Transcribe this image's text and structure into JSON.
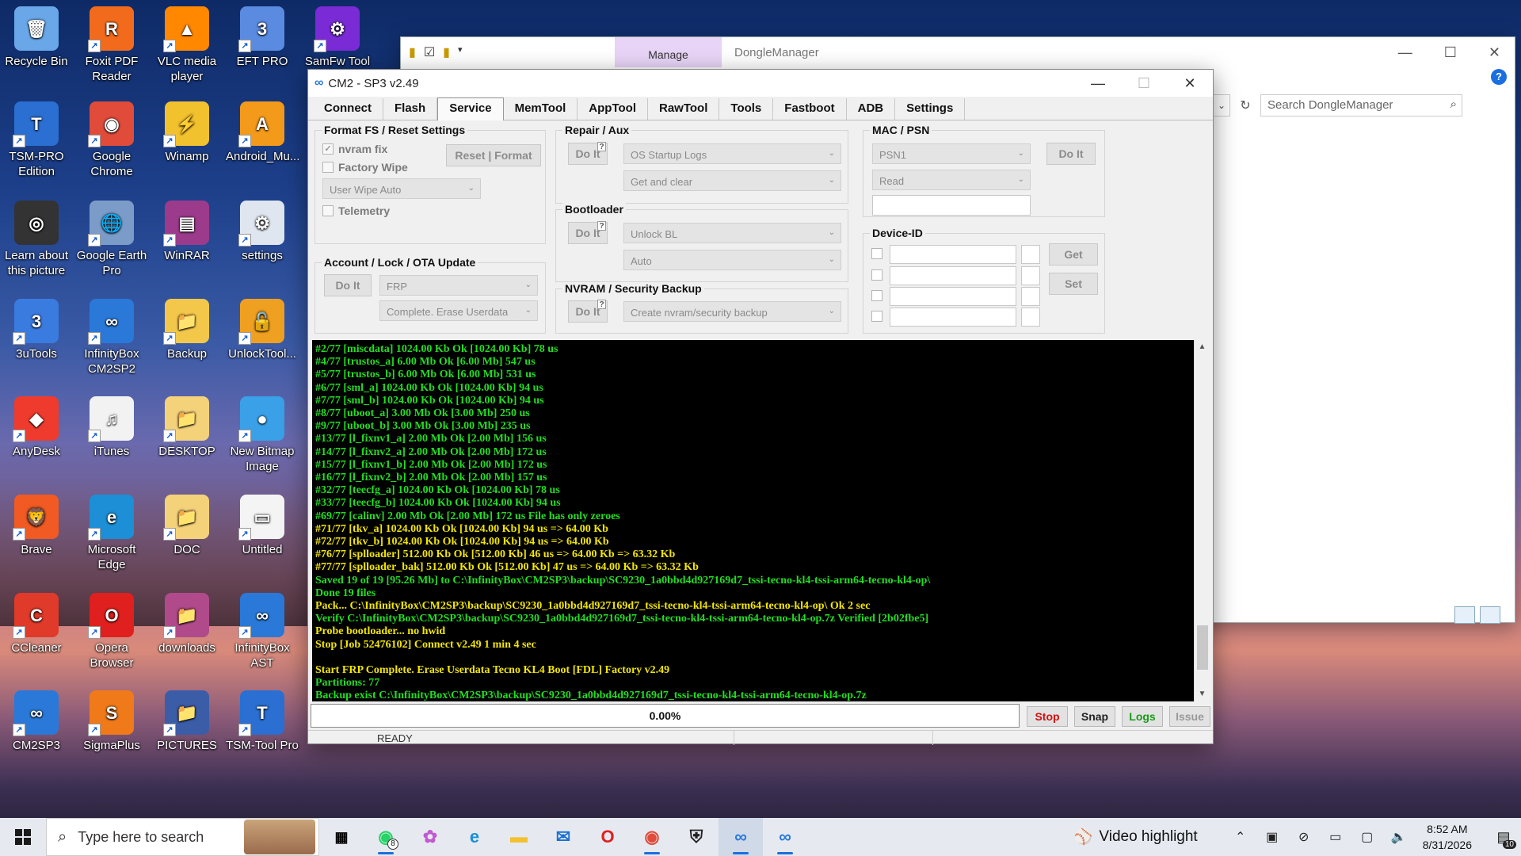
{
  "desktop_icons": [
    {
      "label": "Recycle Bin",
      "icon": "recycle-bin-icon",
      "color": "#6aa7e8",
      "glyph": "🗑"
    },
    {
      "label": "Foxit PDF Reader",
      "icon": "foxit-reader-icon",
      "color": "#f26b1d",
      "glyph": "R"
    },
    {
      "label": "VLC media player",
      "icon": "vlc-icon",
      "color": "#ff8800",
      "glyph": "▲"
    },
    {
      "label": "EFT PRO",
      "icon": "eft-pro-icon",
      "color": "#5a8be0",
      "glyph": "3"
    },
    {
      "label": "SamFw Tool",
      "icon": "samfw-tool-icon",
      "color": "#7a2bd6",
      "glyph": "⚙"
    },
    {
      "label": "TSM-PRO Edition",
      "icon": "tsm-pro-icon",
      "color": "#2a6fd1",
      "glyph": "T"
    },
    {
      "label": "Google Chrome",
      "icon": "chrome-icon",
      "color": "#e04b3a",
      "glyph": "◉"
    },
    {
      "label": "Winamp",
      "icon": "winamp-icon",
      "color": "#f2c12e",
      "glyph": "⚡"
    },
    {
      "label": "Android_Mu...",
      "icon": "android-multitool-icon",
      "color": "#f39a1a",
      "glyph": "A"
    },
    {
      "label": "Learn about this picture",
      "icon": "learn-picture-icon",
      "color": "#333333",
      "glyph": "◎"
    },
    {
      "label": "Google Earth Pro",
      "icon": "google-earth-icon",
      "color": "#7b9cc9",
      "glyph": "🌐"
    },
    {
      "label": "WinRAR",
      "icon": "winrar-icon",
      "color": "#9c3b8c",
      "glyph": "▤"
    },
    {
      "label": "settings",
      "icon": "settings-file-icon",
      "color": "#dfe6ef",
      "glyph": "⚙"
    },
    {
      "label": "3uTools",
      "icon": "3utools-icon",
      "color": "#3a7be0",
      "glyph": "3"
    },
    {
      "label": "InfinityBox CM2SP2",
      "icon": "infinitybox-cm2sp2-icon",
      "color": "#2a79d8",
      "glyph": "∞"
    },
    {
      "label": "Backup",
      "icon": "backup-folder-icon",
      "color": "#f3c84a",
      "glyph": "📁"
    },
    {
      "label": "UnlockTool...",
      "icon": "unlocktool-icon",
      "color": "#f0a020",
      "glyph": "🔓"
    },
    {
      "label": "AnyDesk",
      "icon": "anydesk-icon",
      "color": "#ef3b2d",
      "glyph": "◆"
    },
    {
      "label": "iTunes",
      "icon": "itunes-icon",
      "color": "#f2f2f2",
      "glyph": "♫"
    },
    {
      "label": "DESKTOP",
      "icon": "desktop-folder-icon",
      "color": "#f3d27a",
      "glyph": "📁"
    },
    {
      "label": "New Bitmap Image",
      "icon": "bitmap-image-icon",
      "color": "#3aa0e8",
      "glyph": "●"
    },
    {
      "label": "Brave",
      "icon": "brave-icon",
      "color": "#f15a22",
      "glyph": "🦁"
    },
    {
      "label": "Microsoft Edge",
      "icon": "edge-icon",
      "color": "#1c8fd6",
      "glyph": "e"
    },
    {
      "label": "DOC",
      "icon": "doc-folder-icon",
      "color": "#f3d27a",
      "glyph": "📁"
    },
    {
      "label": "Untitled",
      "icon": "untitled-file-icon",
      "color": "#f4f4f4",
      "glyph": "▭"
    },
    {
      "label": "CCleaner",
      "icon": "ccleaner-icon",
      "color": "#e03a2a",
      "glyph": "C"
    },
    {
      "label": "Opera Browser",
      "icon": "opera-icon",
      "color": "#e0201e",
      "glyph": "O"
    },
    {
      "label": "downloads",
      "icon": "downloads-folder-icon",
      "color": "#b04a8a",
      "glyph": "📁"
    },
    {
      "label": "InfinityBox AST",
      "icon": "infinitybox-ast-icon",
      "color": "#2a79d8",
      "glyph": "∞"
    },
    {
      "label": "CM2SP3",
      "icon": "cm2sp3-icon",
      "color": "#2a79d8",
      "glyph": "∞"
    },
    {
      "label": "SigmaPlus",
      "icon": "sigmaplus-icon",
      "color": "#f07a1a",
      "glyph": "S"
    },
    {
      "label": "PICTURES",
      "icon": "pictures-folder-icon",
      "color": "#3b5da8",
      "glyph": "📁"
    },
    {
      "label": "TSM-Tool Pro",
      "icon": "tsm-tool-pro-icon",
      "color": "#2a6fd1",
      "glyph": "T"
    }
  ],
  "explorer": {
    "manage_tab": "Manage",
    "title": "DongleManager",
    "search_placeholder": "Search DongleManager"
  },
  "cm2": {
    "title": "CM2 - SP3 v2.49",
    "tabs": [
      "Connect",
      "Flash",
      "Service",
      "MemTool",
      "AppTool",
      "RawTool",
      "Tools",
      "Fastboot",
      "ADB",
      "Settings"
    ],
    "active_tab": "Service",
    "format_fs": {
      "title": "Format FS / Reset Settings",
      "nvram_fix": "nvram fix",
      "factory_wipe": "Factory Wipe",
      "reset_format": "Reset | Format",
      "wipe_mode": "User Wipe Auto",
      "telemetry": "Telemetry"
    },
    "account": {
      "title": "Account / Lock / OTA Update",
      "do_it": "Do It",
      "mode": "FRP",
      "action": "Complete. Erase Userdata"
    },
    "repair": {
      "title": "Repair / Aux",
      "do_it": "Do It",
      "mode": "OS Startup Logs",
      "action": "Get and clear"
    },
    "bootloader": {
      "title": "Bootloader",
      "do_it": "Do It",
      "mode": "Unlock BL",
      "action": "Auto"
    },
    "nvram": {
      "title": "NVRAM / Security Backup",
      "do_it": "Do It",
      "mode": "Create nvram/security backup"
    },
    "mac_psn": {
      "title": "MAC / PSN",
      "mode": "PSN1",
      "action": "Read",
      "do_it": "Do It"
    },
    "device_id": {
      "title": "Device-ID",
      "get": "Get",
      "set": "Set"
    },
    "console_lines": [
      {
        "t": "#2/77 [miscdata] 1024.00 Kb Ok [1024.00 Kb] 78 us",
        "c": "g"
      },
      {
        "t": "#4/77 [trustos_a] 6.00 Mb Ok [6.00 Mb] 547 us",
        "c": "g"
      },
      {
        "t": "#5/77 [trustos_b] 6.00 Mb Ok [6.00 Mb] 531 us",
        "c": "g"
      },
      {
        "t": "#6/77 [sml_a] 1024.00 Kb Ok [1024.00 Kb] 94 us",
        "c": "g"
      },
      {
        "t": "#7/77 [sml_b] 1024.00 Kb Ok [1024.00 Kb] 94 us",
        "c": "g"
      },
      {
        "t": "#8/77 [uboot_a] 3.00 Mb Ok [3.00 Mb] 250 us",
        "c": "g"
      },
      {
        "t": "#9/77 [uboot_b] 3.00 Mb Ok [3.00 Mb] 235 us",
        "c": "g"
      },
      {
        "t": "#13/77 [l_fixnv1_a] 2.00 Mb Ok [2.00 Mb] 156 us",
        "c": "g"
      },
      {
        "t": "#14/77 [l_fixnv2_a] 2.00 Mb Ok [2.00 Mb] 172 us",
        "c": "g"
      },
      {
        "t": "#15/77 [l_fixnv1_b] 2.00 Mb Ok [2.00 Mb] 172 us",
        "c": "g"
      },
      {
        "t": "#16/77 [l_fixnv2_b] 2.00 Mb Ok [2.00 Mb] 157 us",
        "c": "g"
      },
      {
        "t": "#32/77 [teecfg_a] 1024.00 Kb Ok [1024.00 Kb] 78 us",
        "c": "g"
      },
      {
        "t": "#33/77 [teecfg_b] 1024.00 Kb Ok [1024.00 Kb] 94 us",
        "c": "g"
      },
      {
        "t": "#69/77 [calinv] 2.00 Mb Ok [2.00 Mb] 172 us File has only zeroes",
        "c": "g"
      },
      {
        "t": "#71/77 [tkv_a] 1024.00 Kb Ok [1024.00 Kb] 94 us => 64.00 Kb",
        "c": "y"
      },
      {
        "t": "#72/77 [tkv_b] 1024.00 Kb Ok [1024.00 Kb] 94 us => 64.00 Kb",
        "c": "y"
      },
      {
        "t": "#76/77 [splloader] 512.00 Kb Ok [512.00 Kb] 46 us => 64.00 Kb => 63.32 Kb",
        "c": "y"
      },
      {
        "t": "#77/77 [splloader_bak] 512.00 Kb Ok [512.00 Kb] 47 us => 64.00 Kb => 63.32 Kb",
        "c": "y"
      },
      {
        "t": "Saved 19 of 19 [95.26 Mb] to C:\\InfinityBox\\CM2SP3\\backup\\SC9230_1a0bbd4d927169d7_tssi-tecno-kl4-tssi-arm64-tecno-kl4-op\\",
        "c": "g"
      },
      {
        "t": "Done 19 files",
        "c": "g"
      },
      {
        "t": "Pack... C:\\InfinityBox\\CM2SP3\\backup\\SC9230_1a0bbd4d927169d7_tssi-tecno-kl4-tssi-arm64-tecno-kl4-op\\ Ok 2 sec",
        "c": "y"
      },
      {
        "t": "Verify C:\\InfinityBox\\CM2SP3\\backup\\SC9230_1a0bbd4d927169d7_tssi-tecno-kl4-tssi-arm64-tecno-kl4-op.7z Verified [2b02fbe5]",
        "c": "g"
      },
      {
        "t": "Probe bootloader... no hwid",
        "c": "y"
      },
      {
        "t": "Stop [Job 52476102] Connect v2.49 1 min 4 sec",
        "c": "y"
      },
      {
        "t": "",
        "c": "g"
      },
      {
        "t": "Start FRP Complete. Erase Userdata Tecno KL4 Boot [FDL] Factory v2.49",
        "c": "y"
      },
      {
        "t": "Partitions: 77",
        "c": "g"
      },
      {
        "t": "Backup exist C:\\InfinityBox\\CM2SP3\\backup\\SC9230_1a0bbd4d927169d7_tssi-tecno-kl4-tssi-arm64-tecno-kl4-op.7z",
        "c": "g"
      }
    ],
    "progress": "0.00%",
    "progress_value": 0,
    "buttons": {
      "stop": "Stop",
      "snap": "Snap",
      "logs": "Logs",
      "issue": "Issue"
    },
    "status": "READY"
  },
  "taskbar": {
    "search_placeholder": "Type here to search",
    "whatsapp_badge": "8",
    "video_highlight": "Video highlight",
    "time": "8:52 AM",
    "date": "8/31/2026",
    "notification_count": "10"
  },
  "colors": {
    "console_green": "#22dd22",
    "console_yellow": "#f2e600",
    "stop_red": "#d01010",
    "logs_green": "#1a9a1a",
    "accent_blue": "#1a6fe0"
  }
}
